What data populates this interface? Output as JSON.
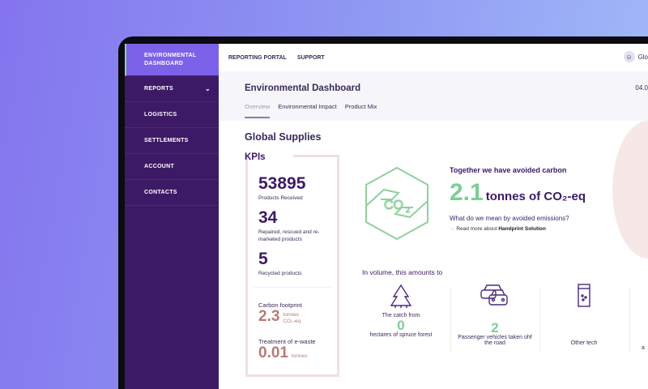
{
  "sidebar": {
    "items": [
      {
        "label": "ENVIRONMENTAL DASHBOARD"
      },
      {
        "label": "REPORTS"
      },
      {
        "label": "LOGISTICS"
      },
      {
        "label": "SETTLEMENTS"
      },
      {
        "label": "ACCOUNT"
      },
      {
        "label": "CONTACTS"
      }
    ]
  },
  "topbar": {
    "links": [
      "REPORTING PORTAL",
      "SUPPORT"
    ],
    "user": "Glo"
  },
  "header": {
    "title": "Environmental Dashboard",
    "date": "04.0",
    "tabs": [
      "Overview",
      "Environmental Impact",
      "Product Mix"
    ]
  },
  "section_title": "Global Supplies",
  "kpis": {
    "title": "KPIs",
    "items": [
      {
        "value": "53895",
        "label": "Products Received"
      },
      {
        "value": "34",
        "label": "Repaired, rescued and re-marketed products"
      },
      {
        "value": "5",
        "label": "Recycled products"
      }
    ],
    "carbon": {
      "label": "Carbon footprint",
      "value": "2.3",
      "unit1": "tonnes",
      "unit2": "CO₂-eq"
    },
    "ewaste": {
      "label": "Treatment of e-waste",
      "value": "0.01",
      "unit": "tonnes"
    }
  },
  "avoided": {
    "title": "Together we have avoided carbon",
    "value": "2.1",
    "unit": "tonnes of CO₂-eq",
    "question": "What do we mean by avoided emissions?",
    "link_prefix": "Read more about ",
    "link_bold": "Handprint Solution"
  },
  "volume": {
    "title": "In volume, this amounts to",
    "items": [
      {
        "pre": "The catch from",
        "value": "0",
        "label": "hectares of spruce forest"
      },
      {
        "pre": "",
        "value": "2",
        "label": "Passenger vehicles taken ohf the road"
      },
      {
        "pre": "",
        "value": "",
        "label": "Other tech"
      }
    ],
    "partial": "a"
  },
  "colors": {
    "sidebar": "#3d1a66",
    "active": "#7b62e8",
    "green": "#7ccf95",
    "rose": "#b97a78"
  }
}
